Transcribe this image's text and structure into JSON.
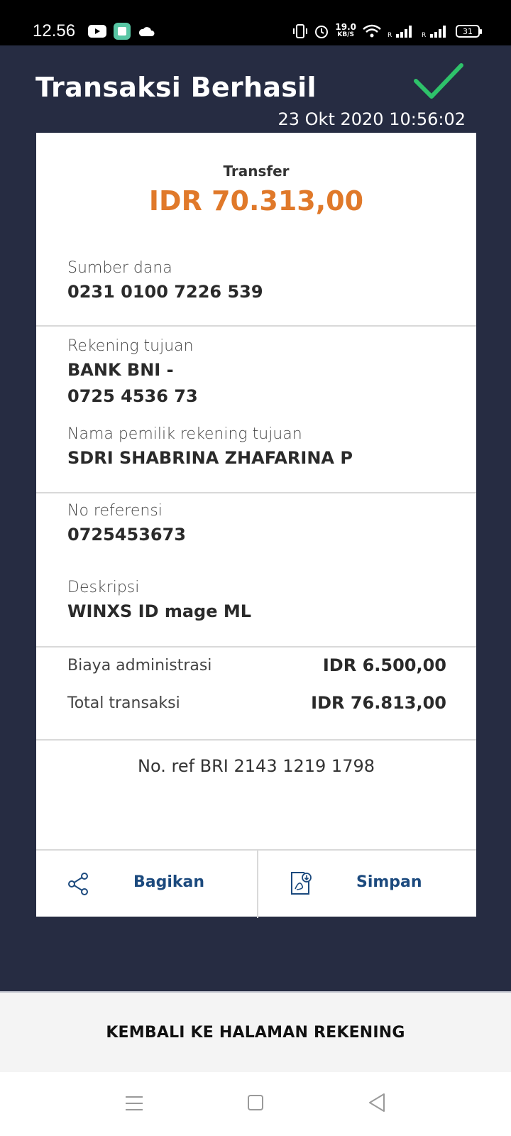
{
  "status_bar": {
    "time": "12.56",
    "net_speed_value": "19.0",
    "net_speed_unit": "KB/S",
    "battery": "31",
    "icons_left": [
      "youtube-icon",
      "app-icon",
      "cloud-icon"
    ],
    "icons_right": [
      "vibrate-icon",
      "alarm-icon",
      "wifi-icon",
      "signal-icon",
      "signal-icon"
    ]
  },
  "header": {
    "title": "Transaksi Berhasil",
    "timestamp": "23 Okt 2020 10:56:02",
    "status_icon": "check-icon",
    "check_color": "#2ec26a"
  },
  "transaction": {
    "type": "Transfer",
    "amount": "IDR 70.313,00",
    "amount_color": "#e0792a",
    "source_label": "Sumber dana",
    "source_value": "0231 0100 7226 539",
    "dest_label": "Rekening tujuan",
    "dest_bank": "BANK BNI -",
    "dest_account": "0725 4536 73",
    "dest_owner_label": "Nama pemilik rekening tujuan",
    "dest_owner_value": "SDRI SHABRINA  ZHAFARINA P",
    "ref_label": "No referensi",
    "ref_value": "0725453673",
    "desc_label": "Deskripsi",
    "desc_value": "WINXS ID mage ML",
    "fee_label": "Biaya administrasi",
    "fee_value": "IDR 6.500,00",
    "total_label": "Total transaksi",
    "total_value": "IDR 76.813,00",
    "bri_ref": "No. ref BRI 2143 1219 1798"
  },
  "actions": {
    "share_label": "Bagikan",
    "save_label": "Simpan",
    "link_color": "#1c4a7e"
  },
  "footer": {
    "back_label": "KEMBALI KE HALAMAN REKENING"
  },
  "nav": {
    "icons": [
      "menu-icon",
      "home-icon",
      "back-icon"
    ]
  }
}
